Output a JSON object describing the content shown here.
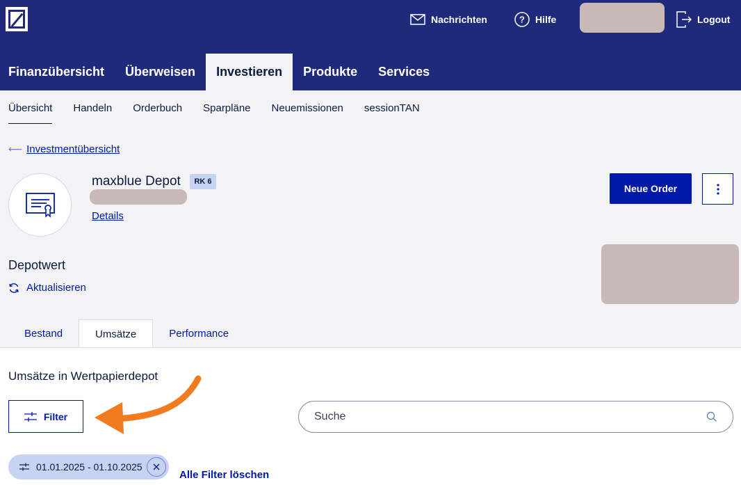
{
  "header": {
    "logo_name": "deutsche-bank-logo",
    "messages_label": "Nachrichten",
    "help_label": "Hilfe",
    "logout_label": "Logout"
  },
  "main_nav": [
    "Finanzübersicht",
    "Überweisen",
    "Investieren",
    "Produkte",
    "Services"
  ],
  "main_nav_active": "Investieren",
  "sub_nav": [
    "Übersicht",
    "Handeln",
    "Orderbuch",
    "Sparpläne",
    "Neuemissionen",
    "sessionTAN"
  ],
  "sub_nav_active": "Übersicht",
  "back_link": "Investmentübersicht",
  "depot": {
    "title": "maxblue Depot",
    "risk_badge": "RK 6",
    "details_link": "Details",
    "new_order_label": "Neue Order",
    "value_label": "Depotwert",
    "refresh_label": "Aktualisieren"
  },
  "tabs": [
    "Bestand",
    "Umsätze",
    "Performance"
  ],
  "tabs_active": "Umsätze",
  "section_title": "Umsätze in Wertpapierdepot",
  "filter_label": "Filter",
  "search": {
    "placeholder": "Suche"
  },
  "active_filter_chip": "01.01.2025 - 01.10.2025",
  "clear_filters_label": "Alle Filter löschen",
  "colors": {
    "header_bg": "#1f2a7a",
    "primary": "#0018a8",
    "chip_bg": "#c7d3f3",
    "annotation_arrow": "#f07c1f",
    "redaction": "#c8b8b8"
  }
}
